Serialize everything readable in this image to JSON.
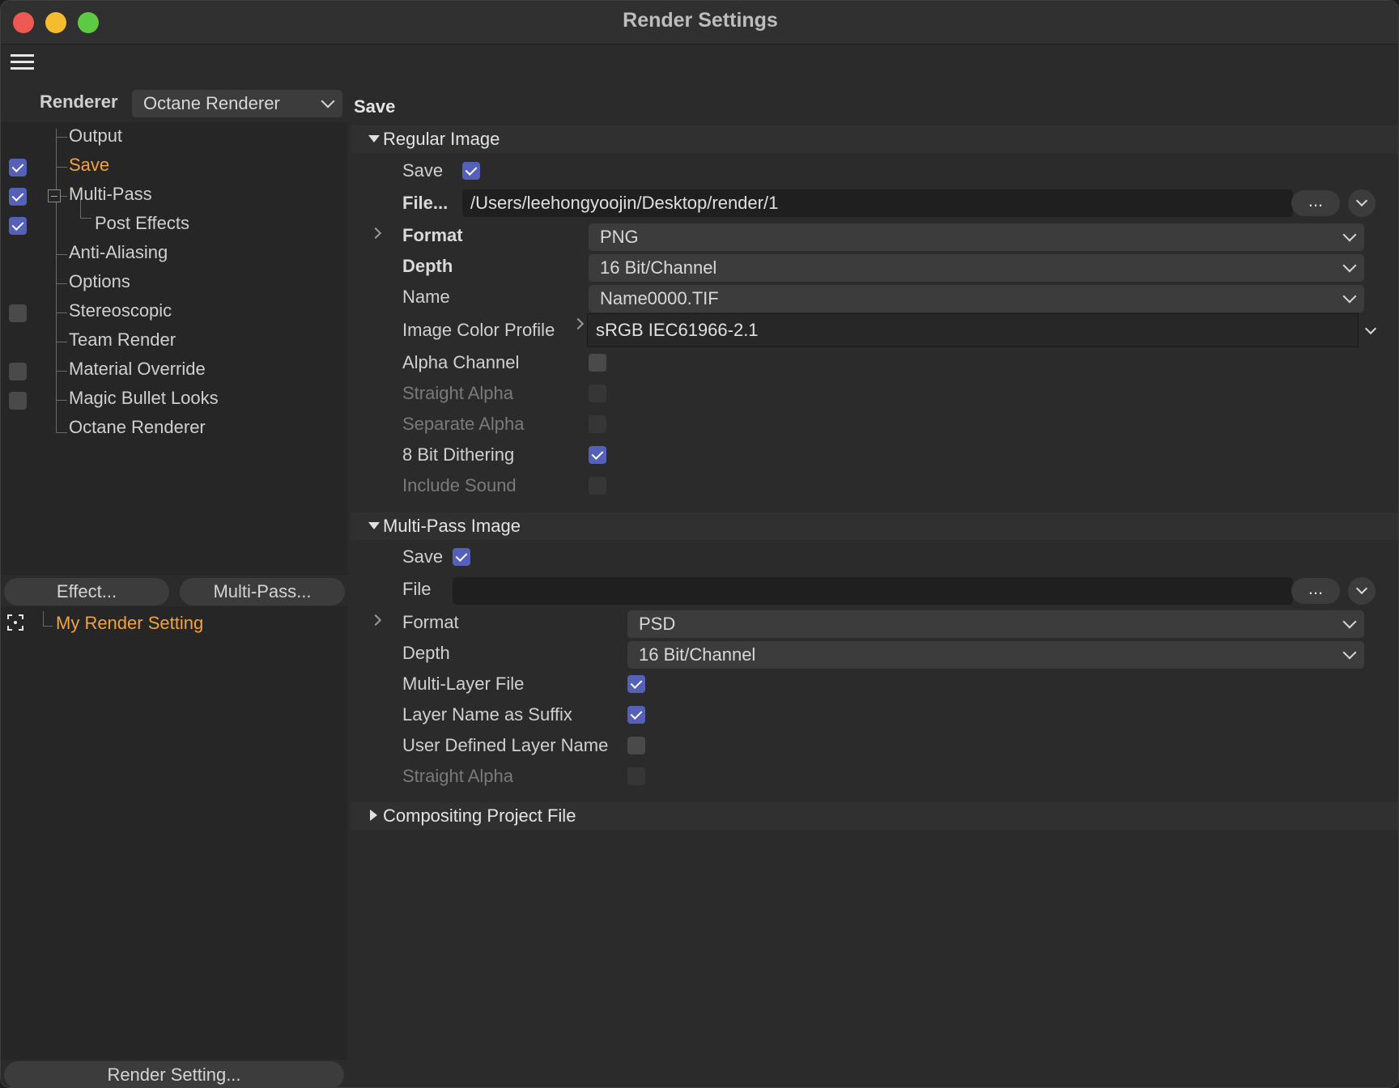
{
  "window": {
    "title": "Render Settings"
  },
  "left": {
    "renderer_label": "Renderer",
    "renderer_value": "Octane Renderer",
    "tree": [
      {
        "label": "Output",
        "checkbox": "none",
        "active": false
      },
      {
        "label": "Save",
        "checkbox": "on",
        "active": true
      },
      {
        "label": "Multi-Pass",
        "checkbox": "on",
        "active": false
      },
      {
        "label": "Post Effects",
        "checkbox": "on",
        "active": false
      },
      {
        "label": "Anti-Aliasing",
        "checkbox": "none",
        "active": false
      },
      {
        "label": "Options",
        "checkbox": "none",
        "active": false
      },
      {
        "label": "Stereoscopic",
        "checkbox": "off",
        "active": false
      },
      {
        "label": "Team Render",
        "checkbox": "none",
        "active": false
      },
      {
        "label": "Material Override",
        "checkbox": "off",
        "active": false
      },
      {
        "label": "Magic Bullet Looks",
        "checkbox": "off",
        "active": false
      },
      {
        "label": "Octane Renderer",
        "checkbox": "none",
        "active": false
      }
    ],
    "effect_button": "Effect...",
    "multipass_button": "Multi-Pass...",
    "setting_item": "My Render Setting",
    "render_setting_button": "Render Setting..."
  },
  "main": {
    "heading": "Save",
    "regular": {
      "section": "Regular Image",
      "save_label": "Save",
      "save_checked": true,
      "file_label": "File...",
      "file_value": "/Users/leehongyoojin/Desktop/render/1",
      "dots": "...",
      "format_label": "Format",
      "format_value": "PNG",
      "depth_label": "Depth",
      "depth_value": "16 Bit/Channel",
      "name_label": "Name",
      "name_value": "Name0000.TIF",
      "profile_label": "Image Color Profile",
      "profile_value": "sRGB IEC61966-2.1",
      "alpha_label": "Alpha Channel",
      "straight_label": "Straight Alpha",
      "separate_label": "Separate Alpha",
      "dither_label": "8 Bit Dithering",
      "sound_label": "Include Sound"
    },
    "multipass": {
      "section": "Multi-Pass Image",
      "save_label": "Save",
      "file_label": "File",
      "file_value": "",
      "dots": "...",
      "format_label": "Format",
      "format_value": "PSD",
      "depth_label": "Depth",
      "depth_value": "16 Bit/Channel",
      "multilayer_label": "Multi-Layer File",
      "suffix_label": "Layer Name as Suffix",
      "userdef_label": "User Defined Layer Name",
      "straight_label": "Straight Alpha"
    },
    "compositing": {
      "section": "Compositing Project File"
    }
  }
}
